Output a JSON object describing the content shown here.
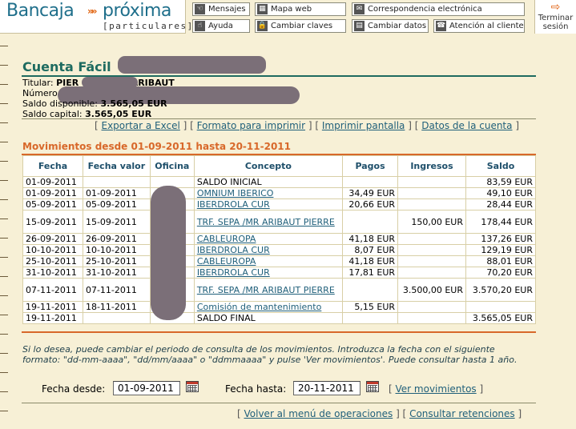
{
  "brand": {
    "name_left": "Bancaja",
    "arrows": "»»",
    "name_right": "próxima",
    "subtitle": "[particulares]"
  },
  "top_nav": [
    {
      "label": "Mensajes",
      "icon": "hand-icon"
    },
    {
      "label": "Mapa web",
      "icon": "sitemap-icon"
    },
    {
      "label": "Correspondencia electrónica",
      "icon": "mail-icon"
    },
    {
      "label": "Ayuda",
      "icon": "help-hand-icon"
    },
    {
      "label": "Cambiar claves",
      "icon": "lock-icon"
    },
    {
      "label": "Cambiar datos",
      "icon": "user-card-icon"
    },
    {
      "label": "Atención al cliente",
      "icon": "phone-icon"
    }
  ],
  "logout": {
    "label_line1": "Terminar",
    "label_line2": "sesión",
    "icon": "exit-arrow-icon"
  },
  "account": {
    "title": "Cuenta Fácil",
    "titular_label": "Titular:",
    "titular_value": "PIER",
    "titular_value_end": "ARIBAUT",
    "numero_label": "Número",
    "saldo_disponible_label": "Saldo disponible:",
    "saldo_disponible": "3.565,05 EUR",
    "saldo_capital_label": "Saldo capital:",
    "saldo_capital": "3.565,05 EUR"
  },
  "actions": {
    "export_excel": "Exportar a Excel",
    "print_format": "Formato para imprimir",
    "print_screen": "Imprimir pantalla",
    "account_data": "Datos de la cuenta"
  },
  "movements": {
    "title": "Movimientos desde 01-09-2011 hasta 20-11-2011",
    "columns": [
      "Fecha",
      "Fecha valor",
      "Oficina",
      "Concepto",
      "Pagos",
      "Ingresos",
      "Saldo"
    ],
    "rows": [
      {
        "fecha": "01-09-2011",
        "valor": "",
        "concepto": "SALDO INICIAL",
        "link": false,
        "pagos": "",
        "ingresos": "",
        "saldo": "83,59 EUR",
        "tall": false
      },
      {
        "fecha": "01-09-2011",
        "valor": "01-09-2011",
        "concepto": "OMNIUM IBERICO",
        "link": true,
        "pagos": "34,49 EUR",
        "ingresos": "",
        "saldo": "49,10 EUR",
        "tall": false
      },
      {
        "fecha": "05-09-2011",
        "valor": "05-09-2011",
        "concepto": "IBERDROLA CUR",
        "link": true,
        "pagos": "20,66 EUR",
        "ingresos": "",
        "saldo": "28,44 EUR",
        "tall": false
      },
      {
        "fecha": "15-09-2011",
        "valor": "15-09-2011",
        "concepto": "TRF. SEPA /MR ARIBAUT PIERRE",
        "link": true,
        "pagos": "",
        "ingresos": "150,00 EUR",
        "saldo": "178,44 EUR",
        "tall": true
      },
      {
        "fecha": "26-09-2011",
        "valor": "26-09-2011",
        "concepto": "CABLEUROPA",
        "link": true,
        "pagos": "41,18 EUR",
        "ingresos": "",
        "saldo": "137,26 EUR",
        "tall": false
      },
      {
        "fecha": "10-10-2011",
        "valor": "10-10-2011",
        "concepto": "IBERDROLA CUR",
        "link": true,
        "pagos": "8,07 EUR",
        "ingresos": "",
        "saldo": "129,19 EUR",
        "tall": false
      },
      {
        "fecha": "25-10-2011",
        "valor": "25-10-2011",
        "concepto": "CABLEUROPA",
        "link": true,
        "pagos": "41,18 EUR",
        "ingresos": "",
        "saldo": "88,01 EUR",
        "tall": false
      },
      {
        "fecha": "31-10-2011",
        "valor": "31-10-2011",
        "concepto": "IBERDROLA CUR",
        "link": true,
        "pagos": "17,81 EUR",
        "ingresos": "",
        "saldo": "70,20 EUR",
        "tall": false
      },
      {
        "fecha": "07-11-2011",
        "valor": "07-11-2011",
        "concepto": "TRF. SEPA /MR ARIBAUT PIERRE",
        "link": true,
        "pagos": "",
        "ingresos": "3.500,00 EUR",
        "saldo": "3.570,20 EUR",
        "tall": true
      },
      {
        "fecha": "19-11-2011",
        "valor": "18-11-2011",
        "concepto": "Comisión de mantenimiento",
        "link": true,
        "pagos": "5,15 EUR",
        "ingresos": "",
        "saldo": "",
        "tall": false
      },
      {
        "fecha": "19-11-2011",
        "valor": "",
        "concepto": "SALDO FINAL",
        "link": false,
        "pagos": "",
        "ingresos": "",
        "saldo": "3.565,05 EUR",
        "tall": false
      }
    ]
  },
  "help_text": "Si lo desea, puede cambiar el periodo de consulta de los movimientos. Introduzca la fecha con el siguiente formato: \"dd-mm-aaaa\", \"dd/mm/aaaa\" o \"ddmmaaaa\" y pulse 'Ver movimientos'. Puede consultar hasta 1 año.",
  "filter": {
    "from_label": "Fecha desde:",
    "from_value": "01-09-2011",
    "to_label": "Fecha hasta:",
    "to_value": "20-11-2011",
    "submit": "Ver movimientos"
  },
  "footer_links": {
    "back": "Volver al menú de operaciones",
    "retentions": "Consultar retenciones"
  },
  "colors": {
    "accent_green": "#1e6b60",
    "accent_orange": "#d8682a",
    "link": "#1f5f7a",
    "background": "#f7f0d6"
  }
}
